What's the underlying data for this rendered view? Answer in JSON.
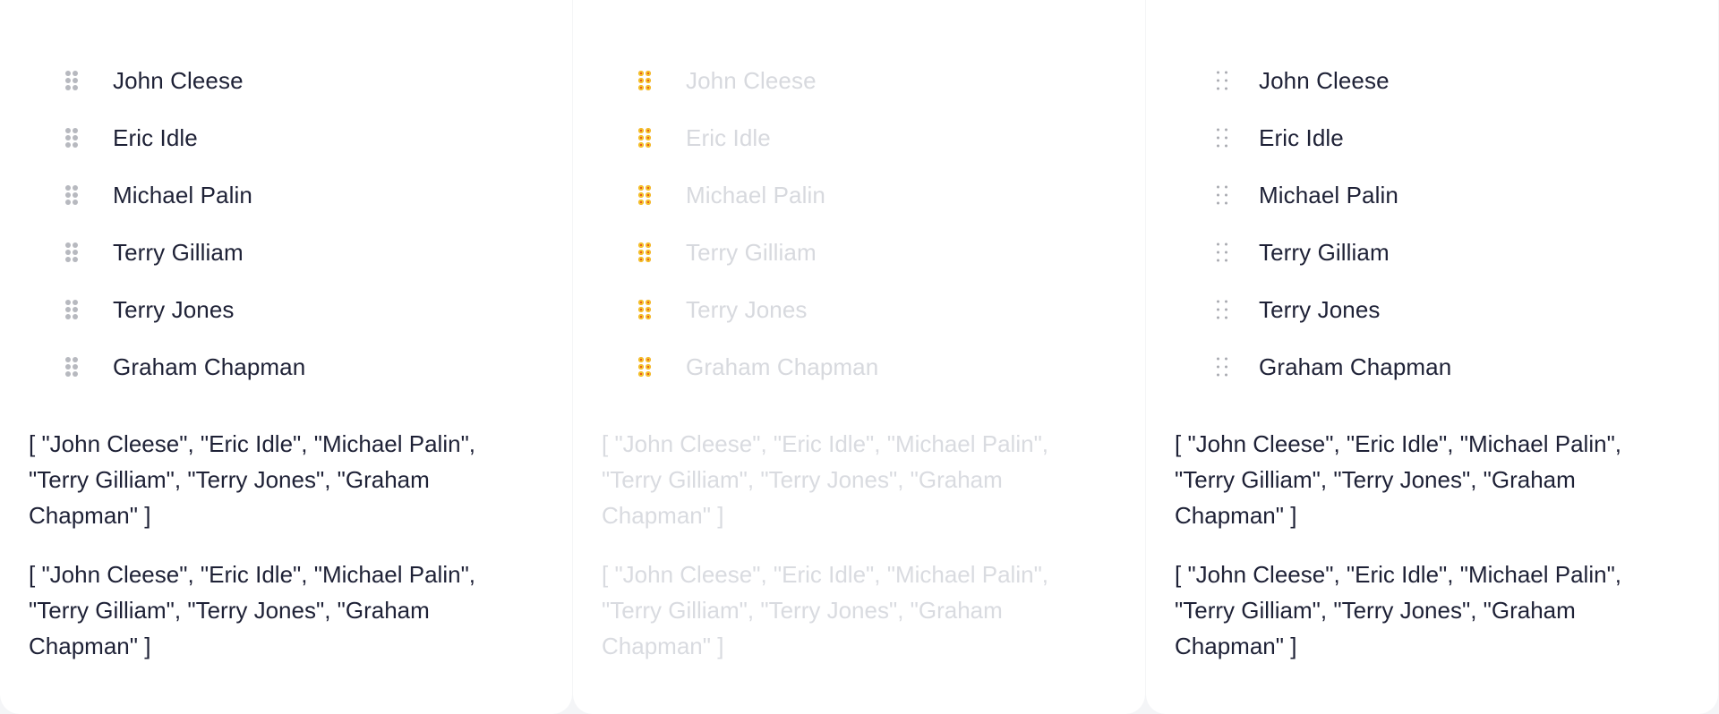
{
  "panels": [
    {
      "items": [
        "John Cleese",
        "Eric Idle",
        "Michael Palin",
        "Terry Gilliam",
        "Terry Jones",
        "Graham Chapman"
      ],
      "output1": "[ \"John Cleese\", \"Eric Idle\", \"Michael Palin\", \"Terry Gilliam\", \"Terry Jones\", \"Graham Chapman\" ]",
      "output2": "[ \"John Cleese\", \"Eric Idle\", \"Michael Palin\", \"Terry Gilliam\", \"Terry Jones\", \"Graham Chapman\" ]",
      "handle_color": "#b7b9bf",
      "text_color": "#1e2136"
    },
    {
      "items": [
        "John Cleese",
        "Eric Idle",
        "Michael Palin",
        "Terry Gilliam",
        "Terry Jones",
        "Graham Chapman"
      ],
      "output1": "[ \"John Cleese\", \"Eric Idle\", \"Michael Palin\", \"Terry Gilliam\", \"Terry Jones\", \"Graham Chapman\" ]",
      "output2": "[ \"John Cleese\", \"Eric Idle\", \"Michael Palin\", \"Terry Gilliam\", \"Terry Jones\", \"Graham Chapman\" ]",
      "handle_color": "#e23a1b",
      "text_color": "#d7d9de"
    },
    {
      "items": [
        "John Cleese",
        "Eric Idle",
        "Michael Palin",
        "Terry Gilliam",
        "Terry Jones",
        "Graham Chapman"
      ],
      "output1": "[ \"John Cleese\", \"Eric Idle\", \"Michael Palin\", \"Terry Gilliam\", \"Terry Jones\", \"Graham Chapman\" ]",
      "output2": "[ \"John Cleese\", \"Eric Idle\", \"Michael Palin\", \"Terry Gilliam\", \"Terry Jones\", \"Graham Chapman\" ]",
      "handle_color": "#a9abb1",
      "text_color": "#1e2136"
    }
  ],
  "icons": {
    "drag_handle": "drag-handle-icon"
  }
}
